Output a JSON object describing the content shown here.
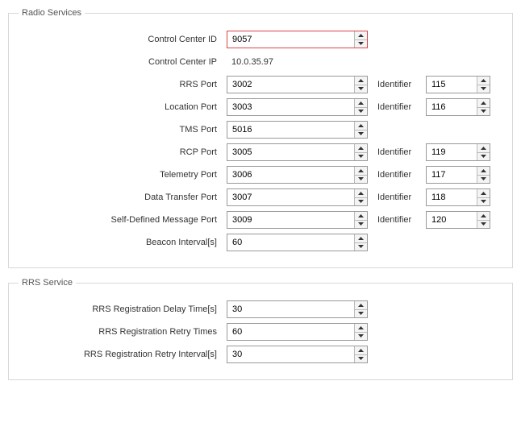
{
  "radio_services": {
    "legend": "Radio Services",
    "control_center_id": {
      "label": "Control Center ID",
      "value": "9057"
    },
    "control_center_ip": {
      "label": "Control Center IP",
      "value": "10.0.35.97"
    },
    "rrs_port": {
      "label": "RRS Port",
      "value": "3002",
      "id_label": "Identifier",
      "id_value": "115"
    },
    "location_port": {
      "label": "Location Port",
      "value": "3003",
      "id_label": "Identifier",
      "id_value": "116"
    },
    "tms_port": {
      "label": "TMS Port",
      "value": "5016"
    },
    "rcp_port": {
      "label": "RCP Port",
      "value": "3005",
      "id_label": "Identifier",
      "id_value": "119"
    },
    "telemetry_port": {
      "label": "Telemetry Port",
      "value": "3006",
      "id_label": "Identifier",
      "id_value": "117"
    },
    "data_transfer_port": {
      "label": "Data Transfer Port",
      "value": "3007",
      "id_label": "Identifier",
      "id_value": "118"
    },
    "self_defined_message_port": {
      "label": "Self-Defined Message Port",
      "value": "3009",
      "id_label": "Identifier",
      "id_value": "120"
    },
    "beacon_interval": {
      "label": "Beacon Interval[s]",
      "value": "60"
    }
  },
  "rrs_service": {
    "legend": "RRS Service",
    "reg_delay": {
      "label": "RRS Registration Delay Time[s]",
      "value": "30"
    },
    "retry_times": {
      "label": "RRS Registration Retry Times",
      "value": "60"
    },
    "retry_interval": {
      "label": "RRS Registration Retry Interval[s]",
      "value": "30"
    }
  }
}
